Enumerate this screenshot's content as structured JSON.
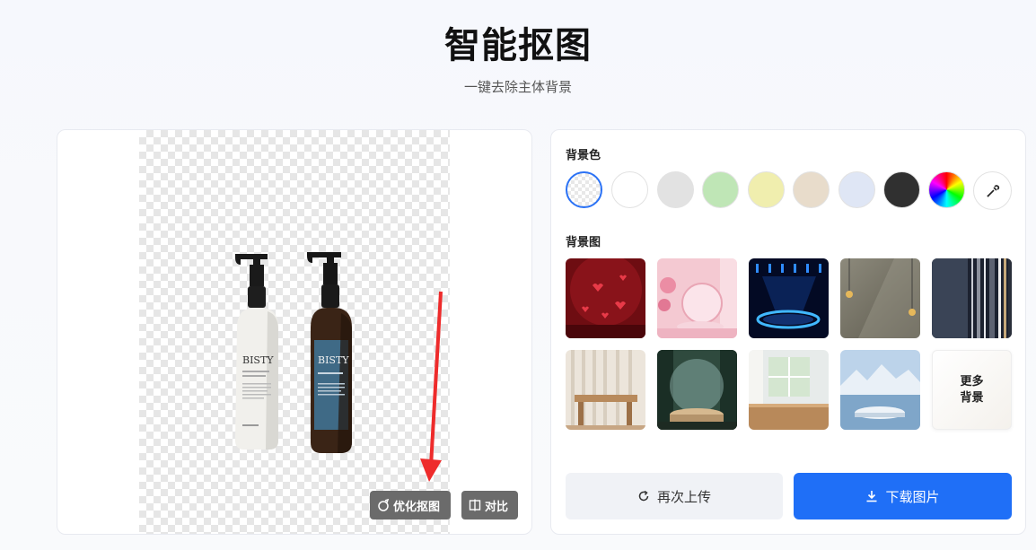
{
  "header": {
    "title": "智能抠图",
    "subtitle": "一键去除主体背景"
  },
  "preview": {
    "refine_label": "优化抠图",
    "compare_label": "对比",
    "product_labels": [
      "BISTY",
      "BISTY"
    ]
  },
  "controls": {
    "bg_color_label": "背景色",
    "colors": [
      {
        "name": "transparent",
        "hex": "transparent",
        "selected": true
      },
      {
        "name": "white",
        "hex": "#ffffff"
      },
      {
        "name": "light-gray",
        "hex": "#e2e2e2"
      },
      {
        "name": "light-green",
        "hex": "#bfe6b6"
      },
      {
        "name": "light-yellow",
        "hex": "#f0eeae"
      },
      {
        "name": "beige",
        "hex": "#e8dccb"
      },
      {
        "name": "light-blue",
        "hex": "#dfe6f5"
      },
      {
        "name": "dark",
        "hex": "#303030"
      },
      {
        "name": "rainbow",
        "hex": "gradient"
      }
    ],
    "bg_image_label": "背景图",
    "backgrounds": [
      "red-hearts",
      "pink-arch",
      "blue-stage",
      "olive-wall-lamps",
      "dark-stripes",
      "curtain-wooden-table",
      "forest-mist-podium",
      "window-wooden-table",
      "snow-mountain-lake",
      "more"
    ],
    "more_label": "更多\n背景",
    "reupload_label": "再次上传",
    "download_label": "下载图片"
  }
}
